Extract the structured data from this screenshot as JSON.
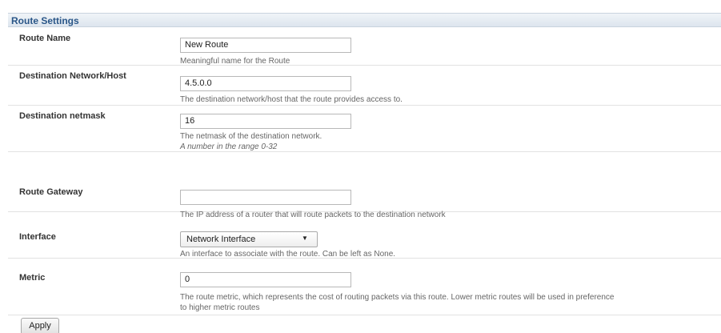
{
  "panel": {
    "title": "Route Settings"
  },
  "fields": {
    "route_name": {
      "label": "Route Name",
      "value": "New Route",
      "help": "Meaningful name for the Route"
    },
    "destination": {
      "label": "Destination Network/Host",
      "value": "4.5.0.0",
      "help": "The destination network/host that the route provides access to."
    },
    "netmask": {
      "label": "Destination netmask",
      "value": "16",
      "help": "The netmask of the destination network.",
      "note": "A number in the range 0-32"
    },
    "gateway": {
      "label": "Route Gateway",
      "value": "",
      "help": "The IP address of a router that will route packets to the destination network"
    },
    "interface": {
      "label": "Interface",
      "selected": "Network Interface",
      "arrow": "▼",
      "help": "An interface to associate with the route. Can be left as None."
    },
    "metric": {
      "label": "Metric",
      "value": "0",
      "help_line1": "The route metric, which represents the cost of routing packets via this route. Lower metric routes will be used in preference",
      "help_line2": "to higher metric routes"
    }
  },
  "actions": {
    "apply_label": "Apply"
  }
}
